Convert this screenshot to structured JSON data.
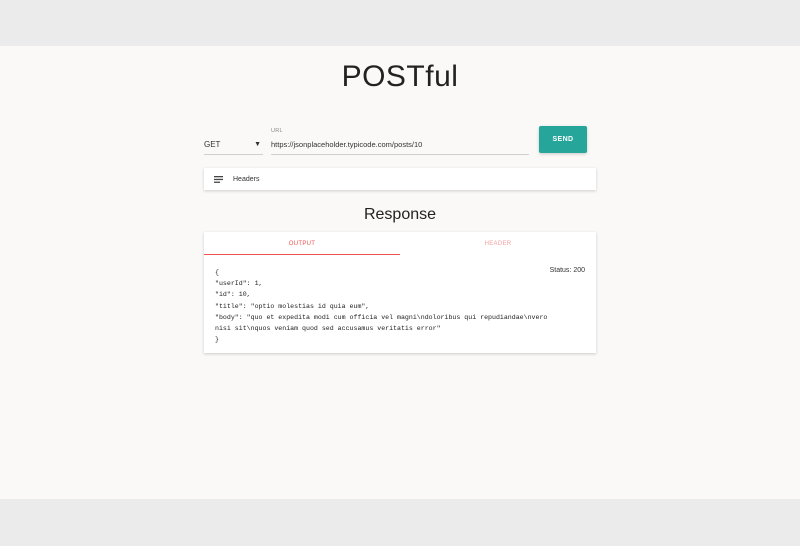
{
  "app": {
    "title": "POSTful"
  },
  "request": {
    "method": "GET",
    "url_label": "URL",
    "url": "https://jsonplaceholder.typicode.com/posts/10",
    "send_label": "SEND",
    "headers_label": "Headers"
  },
  "response": {
    "title": "Response",
    "tabs": [
      "OUTPUT",
      "HEADER"
    ],
    "status": "Status: 200",
    "output_lines": [
      "{",
      "\"userId\": 1,",
      "\"id\": 10,",
      "\"title\": \"optio molestias id quia eum\",",
      "\"body\": \"quo et expedita modi cum officia vel magni\\ndoloribus qui repudiandae\\nvero",
      "nisi sit\\nquos veniam quod sed accusamus veritatis error\"",
      "}"
    ]
  },
  "colors": {
    "accent": "#26a69a",
    "tab_active": "#ef5350",
    "page_bg": "#faf9f7"
  },
  "icons": {
    "headers": "list-icon",
    "method_dropdown": "caret-down-icon"
  }
}
